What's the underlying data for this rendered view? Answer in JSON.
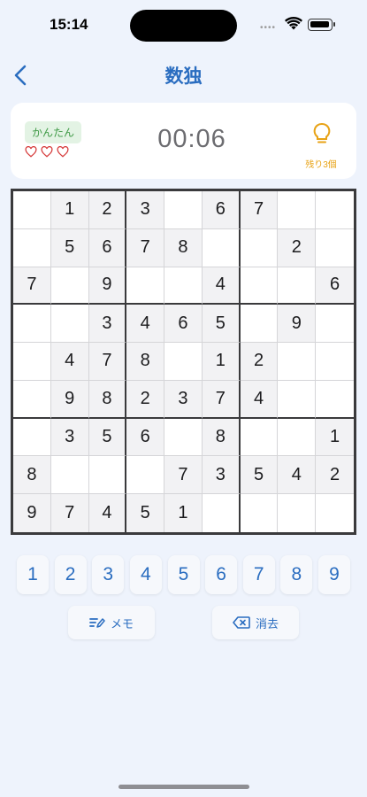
{
  "status_bar": {
    "time": "15:14",
    "dots": "••••"
  },
  "nav": {
    "title": "数独"
  },
  "info": {
    "difficulty": "かんたん",
    "lives": 3,
    "timer": "00:06",
    "hint_label": "残り3個"
  },
  "colors": {
    "accent": "#2a6dc0",
    "hint": "#e8a317",
    "heart": "#d63b3b",
    "difficulty_bg": "#e3f3e4",
    "difficulty_text": "#3f9a46"
  },
  "board": [
    [
      "",
      "1",
      "2",
      "3",
      "",
      "6",
      "7",
      "",
      ""
    ],
    [
      "",
      "5",
      "6",
      "7",
      "8",
      "",
      "",
      "2",
      ""
    ],
    [
      "7",
      "",
      "9",
      "",
      "",
      "4",
      "",
      "",
      "6"
    ],
    [
      "",
      "",
      "3",
      "4",
      "6",
      "5",
      "",
      "9",
      ""
    ],
    [
      "",
      "4",
      "7",
      "8",
      "",
      "1",
      "2",
      "",
      ""
    ],
    [
      "",
      "9",
      "8",
      "2",
      "3",
      "7",
      "4",
      "",
      ""
    ],
    [
      "",
      "3",
      "5",
      "6",
      "",
      "8",
      "",
      "",
      "1"
    ],
    [
      "8",
      "",
      "",
      "",
      "7",
      "3",
      "5",
      "4",
      "2"
    ],
    [
      "9",
      "7",
      "4",
      "5",
      "1",
      "",
      "",
      "",
      ""
    ]
  ],
  "numpad": [
    "1",
    "2",
    "3",
    "4",
    "5",
    "6",
    "7",
    "8",
    "9"
  ],
  "actions": {
    "memo_label": "メモ",
    "erase_label": "消去"
  }
}
